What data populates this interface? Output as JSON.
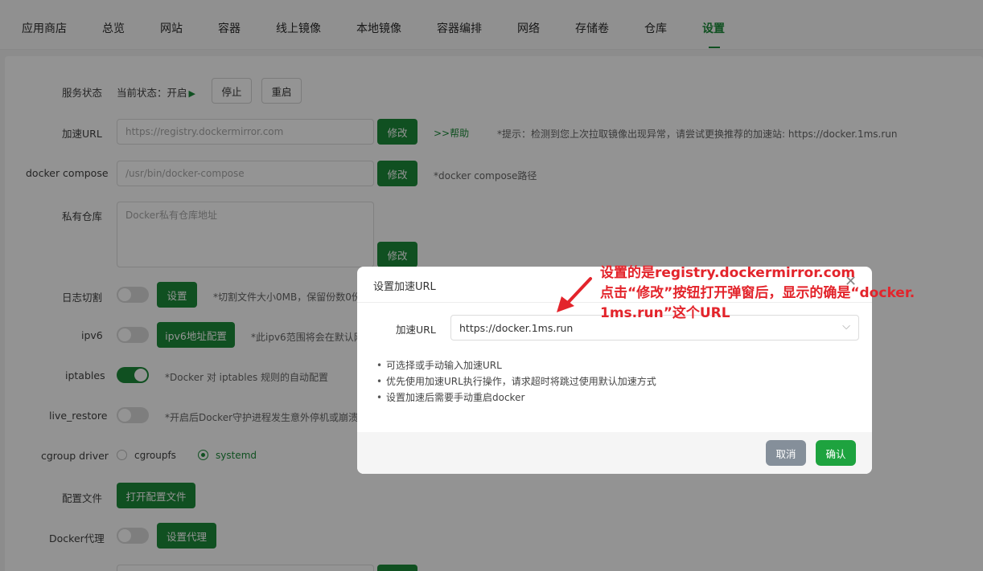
{
  "tabs": [
    "应用商店",
    "总览",
    "网站",
    "容器",
    "线上镜像",
    "本地镜像",
    "容器编排",
    "网络",
    "存储卷",
    "仓库",
    "设置"
  ],
  "active_tab": "设置",
  "service": {
    "label": "服务状态",
    "status_prefix": "当前状态：开启",
    "stop_label": "停止",
    "restart_label": "重启"
  },
  "accel": {
    "label": "加速URL",
    "value": "https://registry.dockermirror.com",
    "edit_label": "修改",
    "help_label": ">>帮助",
    "hint": "*提示：检测到您上次拉取镜像出现异常，请尝试更换推荐的加速站: https://docker.1ms.run"
  },
  "compose": {
    "label": "docker compose",
    "value": "/usr/bin/docker-compose",
    "edit_label": "修改",
    "hint": "*docker compose路径"
  },
  "registry": {
    "label": "私有仓库",
    "placeholder": "Docker私有仓库地址",
    "edit_label": "修改"
  },
  "log": {
    "label": "日志切割",
    "button": "设置",
    "hint": "*切割文件大小0MB，保留份数0份"
  },
  "ipv6": {
    "label": "ipv6",
    "button": "ipv6地址配置",
    "hint": "*此ipv6范围将会在默认网"
  },
  "iptables": {
    "label": "iptables",
    "enabled": true,
    "hint": "*Docker 对 iptables 规则的自动配置"
  },
  "live_restore": {
    "label": "live_restore",
    "hint": "*开启后Docker守护进程发生意外停机或崩溃"
  },
  "cgroup": {
    "label": "cgroup driver",
    "options": [
      "cgroupfs",
      "systemd"
    ],
    "selected": "systemd"
  },
  "config_file": {
    "label": "配置文件",
    "button": "打开配置文件"
  },
  "proxy": {
    "label": "Docker代理",
    "button": "设置代理"
  },
  "dialog": {
    "title": "设置加速URL",
    "field_label": "加速URL",
    "field_value": "https://docker.1ms.run",
    "tips": [
      "可选择或手动输入加速URL",
      "优先使用加速URL执行操作，请求超时将跳过使用默认加速方式",
      "设置加速后需要手动重启docker"
    ],
    "cancel_label": "取消",
    "confirm_label": "确认"
  },
  "annotation": {
    "line1": "设置的是registry.dockermirror.com",
    "line2": "点击“修改”按钮打开弹窗后，显示的确是“docker.",
    "line3": "1ms.run”这个URL"
  },
  "colors": {
    "accent": "#1d8a3a",
    "annotation": "#e3242b",
    "confirm": "#1ea33f",
    "cancel": "#858f9a"
  }
}
